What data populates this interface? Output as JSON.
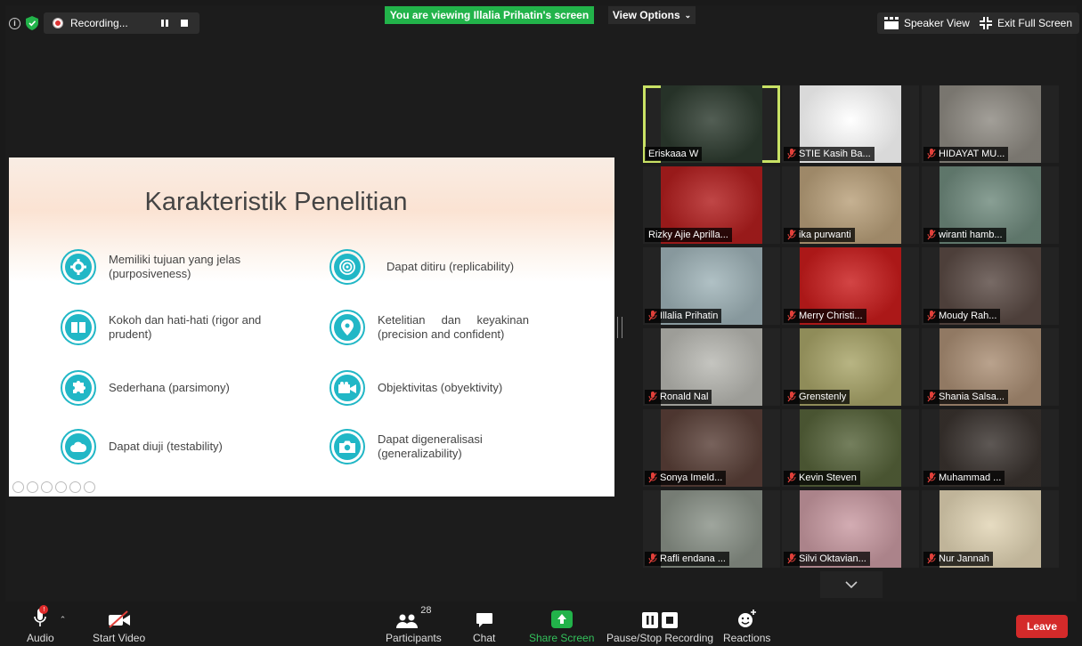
{
  "topbar": {
    "recording_label": "Recording...",
    "viewing_banner": "You are viewing Illalia Prihatin's screen",
    "view_options_label": "View Options",
    "speaker_view_label": "Speaker View",
    "exit_fullscreen_label": "Exit Full Screen"
  },
  "slide": {
    "title": "Karakteristik Penelitian",
    "items": [
      {
        "text": "Memiliki tujuan yang jelas (purposiveness)",
        "icon": "gear-icon"
      },
      {
        "text": "Dapat ditiru (replicability)",
        "icon": "target-icon"
      },
      {
        "text": "Kokoh dan hati-hati (rigor and prudent)",
        "icon": "book-icon"
      },
      {
        "text": "Ketelitian dan keyakinan (precision and confident)",
        "icon": "location-pin-icon"
      },
      {
        "text": "Sederhana (parsimony)",
        "icon": "puzzle-icon"
      },
      {
        "text": "Objektivitas (obyektivity)",
        "icon": "video-camera-icon"
      },
      {
        "text": "Dapat diuji (testability)",
        "icon": "cloud-icon"
      },
      {
        "text": "Dapat digeneralisasi (generalizability)",
        "icon": "camera-icon"
      }
    ]
  },
  "participants_gallery": [
    {
      "name": "Eriskaaa W",
      "muted": false,
      "active": true,
      "bg": "#2d3b2f"
    },
    {
      "name": "STIE Kasih Ba...",
      "muted": true,
      "active": false,
      "bg": "#ffffff"
    },
    {
      "name": "HIDAYAT MU...",
      "muted": true,
      "active": false,
      "bg": "#8e8a82"
    },
    {
      "name": "Rizky Ajie Aprilla...",
      "muted": false,
      "active": false,
      "bg": "#b21e1e"
    },
    {
      "name": "ika purwanti",
      "muted": true,
      "active": false,
      "bg": "#b9a07a"
    },
    {
      "name": "wiranti hamb...",
      "muted": true,
      "active": false,
      "bg": "#6f8a7d"
    },
    {
      "name": "Illalia Prihatin",
      "muted": true,
      "active": false,
      "bg": "#9fb3b8"
    },
    {
      "name": "Merry Christi...",
      "muted": true,
      "active": false,
      "bg": "#c91c1c"
    },
    {
      "name": "Moudy Rah...",
      "muted": true,
      "active": false,
      "bg": "#5a4a44"
    },
    {
      "name": "Ronald Nal",
      "muted": true,
      "active": false,
      "bg": "#b8b8b2"
    },
    {
      "name": "Grenstenly",
      "muted": true,
      "active": false,
      "bg": "#a8a468"
    },
    {
      "name": "Shania Salsa...",
      "muted": true,
      "active": false,
      "bg": "#aa8e74"
    },
    {
      "name": "Sonya Imeld...",
      "muted": true,
      "active": false,
      "bg": "#5a4038"
    },
    {
      "name": "Kevin Steven",
      "muted": true,
      "active": false,
      "bg": "#56633a"
    },
    {
      "name": "Muhammad ...",
      "muted": true,
      "active": false,
      "bg": "#3a332f"
    },
    {
      "name": "Rafli endana ...",
      "muted": true,
      "active": false,
      "bg": "#8a9288"
    },
    {
      "name": "Silvi Oktavian...",
      "muted": true,
      "active": false,
      "bg": "#c99aa2"
    },
    {
      "name": "Nur Jannah",
      "muted": true,
      "active": false,
      "bg": "#e1d4b4"
    }
  ],
  "toolbar": {
    "audio_label": "Audio",
    "video_label": "Start Video",
    "participants_label": "Participants",
    "participants_count": "28",
    "chat_label": "Chat",
    "share_label": "Share Screen",
    "record_label": "Pause/Stop Recording",
    "reactions_label": "Reactions",
    "leave_label": "Leave"
  },
  "colors": {
    "accent_green": "#22b34a",
    "slide_icon_teal": "#21b7c6",
    "leave_red": "#d42a2a",
    "active_speaker_outline": "#c9e265",
    "mute_red": "#e0403a"
  }
}
